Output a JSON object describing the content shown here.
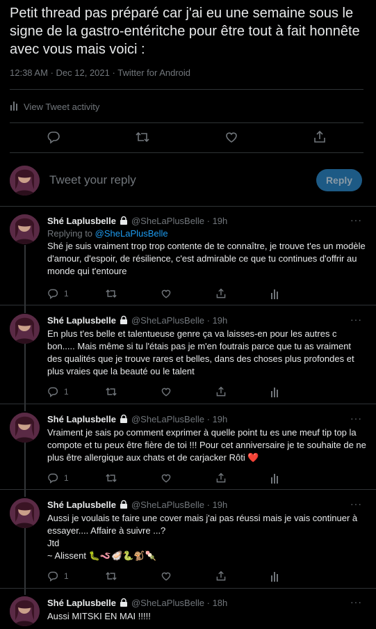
{
  "main_tweet": {
    "text": "Petit thread pas préparé car j'ai eu une semaine sous le signe de la gastro-entéritche pour être tout à fait honnête avec vous mais voici :",
    "time": "12:38 AM",
    "date": "Dec 12, 2021",
    "source": "Twitter for Android",
    "meta_sep": "·",
    "activity_label": "View Tweet activity"
  },
  "reply_box": {
    "placeholder": "Tweet your reply",
    "button_label": "Reply"
  },
  "replies": [
    {
      "name": "Shé Laplusbelle",
      "handle": "@SheLaPlusBelle",
      "time": "19h",
      "replying_prefix": "Replying to",
      "replying_to": "@SheLaPlusBelle",
      "text": "Shé je suis vraiment trop trop contente de te connaître, je trouve t'es un modèle d'amour, d'espoir, de résilience, c'est admirable ce que tu continues d'offrir au monde qui t'entoure",
      "reply_count": "1"
    },
    {
      "name": "Shé Laplusbelle",
      "handle": "@SheLaPlusBelle",
      "time": "19h",
      "text": "En plus t'es belle et talentueuse genre ça va laisses-en pour les autres c bon..... Mais même si tu l'étais pas je m'en foutrais parce que tu as vraiment des qualités que je trouve rares et belles, dans des choses plus profondes et plus vraies que la beauté ou le talent",
      "reply_count": "1"
    },
    {
      "name": "Shé Laplusbelle",
      "handle": "@SheLaPlusBelle",
      "time": "19h",
      "text": "Vraiment je sais po comment exprimer à quelle point tu es une meuf tip top la compote et tu peux être fière de toi !!! Pour cet anniversaire je te souhaite de ne plus être allergique aux chats et de carjacker Rôti",
      "emoji": "❤️",
      "reply_count": "1"
    },
    {
      "name": "Shé Laplusbelle",
      "handle": "@SheLaPlusBelle",
      "time": "19h",
      "line1": "Aussi je voulais te faire une cover mais j'ai pas réussi mais je vais continuer à essayer.... Affaire à suivre ...?",
      "line2": "Jtd",
      "line3": "~ Alissent",
      "emojis": "🐛🪱🦪🐍🐒🍡",
      "reply_count": "1"
    },
    {
      "name": "Shé Laplusbelle",
      "handle": "@SheLaPlusBelle",
      "time": "18h",
      "text": "Aussi MITSKI EN MAI !!!!!"
    }
  ],
  "separator": "·",
  "more_label": "···",
  "colors": {
    "background": "#000000",
    "text": "#e7e9ea",
    "muted": "#71767b",
    "link": "#1d9bf0",
    "reply_button": "#1d5a85",
    "divider": "#2f3336"
  }
}
